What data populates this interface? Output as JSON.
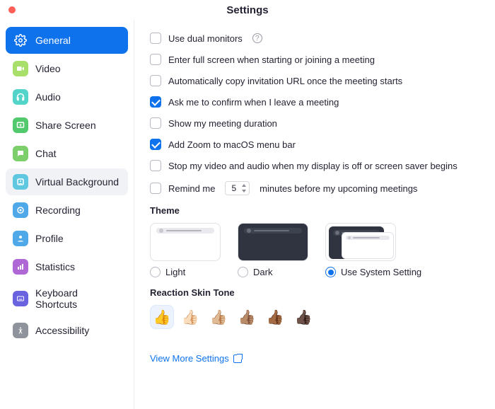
{
  "window": {
    "title": "Settings"
  },
  "sidebar": {
    "items": [
      {
        "label": "General",
        "icon_bg": "#ffffff",
        "icon_fg": "#ffffff"
      },
      {
        "label": "Video",
        "icon_bg": "#a7df6a"
      },
      {
        "label": "Audio",
        "icon_bg": "#52d4c8"
      },
      {
        "label": "Share Screen",
        "icon_bg": "#53c96e"
      },
      {
        "label": "Chat",
        "icon_bg": "#7ccf6a"
      },
      {
        "label": "Virtual Background",
        "icon_bg": "#5fc8e0"
      },
      {
        "label": "Recording",
        "icon_bg": "#4fa8e8"
      },
      {
        "label": "Profile",
        "icon_bg": "#4fa8e8"
      },
      {
        "label": "Statistics",
        "icon_bg": "#b067d6"
      },
      {
        "label": "Keyboard Shortcuts",
        "icon_bg": "#6a63e0"
      },
      {
        "label": "Accessibility",
        "icon_bg": "#8f949c"
      }
    ],
    "active_index": 0,
    "hovered_index": 5
  },
  "options": {
    "dual_monitors": {
      "label": "Use dual monitors",
      "checked": false,
      "help": true
    },
    "full_screen": {
      "label": "Enter full screen when starting or joining a meeting",
      "checked": false
    },
    "copy_url": {
      "label": "Automatically copy invitation URL once the meeting starts",
      "checked": false
    },
    "confirm_leave": {
      "label": "Ask me to confirm when I leave a meeting",
      "checked": true
    },
    "show_duration": {
      "label": "Show my meeting duration",
      "checked": false
    },
    "menubar": {
      "label": "Add Zoom to macOS menu bar",
      "checked": true
    },
    "stop_screensaver": {
      "label": "Stop my video and audio when my display is off or screen saver begins",
      "checked": false
    },
    "remind": {
      "prefix": "Remind me",
      "value": "5",
      "suffix": "minutes before my upcoming meetings",
      "checked": false
    }
  },
  "theme": {
    "title": "Theme",
    "options": [
      {
        "label": "Light"
      },
      {
        "label": "Dark"
      },
      {
        "label": "Use System Setting"
      }
    ],
    "selected_index": 2
  },
  "skin": {
    "title": "Reaction Skin Tone",
    "tones": [
      "👍",
      "👍🏻",
      "👍🏼",
      "👍🏽",
      "👍🏾",
      "👍🏿"
    ],
    "selected_index": 0
  },
  "footer": {
    "view_more": "View More Settings"
  }
}
